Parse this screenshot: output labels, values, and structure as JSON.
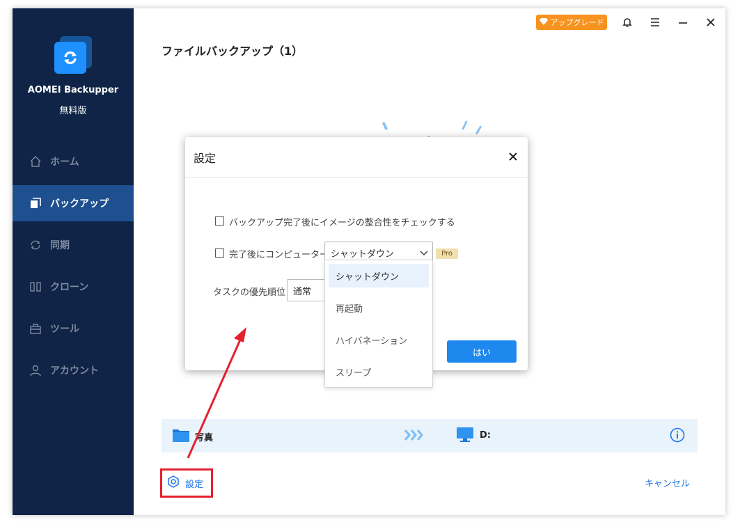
{
  "app": {
    "name": "AOMEI Backupper",
    "edition": "無料版"
  },
  "sidebar": {
    "items": [
      {
        "label": "ホーム",
        "icon": "home-icon"
      },
      {
        "label": "バックアップ",
        "icon": "backup-icon",
        "active": true
      },
      {
        "label": "同期",
        "icon": "sync-icon"
      },
      {
        "label": "クローン",
        "icon": "clone-icon"
      },
      {
        "label": "ツール",
        "icon": "tools-icon"
      },
      {
        "label": "アカウント",
        "icon": "account-icon"
      }
    ]
  },
  "topbar": {
    "upgrade_label": "アップグレード"
  },
  "page": {
    "title": "ファイルバックアップ（1）"
  },
  "dialog": {
    "title": "設定",
    "check_image_label": "バックアップ完了後にイメージの整合性をチェックする",
    "after_complete_label": "完了後にコンピューターを",
    "after_complete_value": "シャットダウン",
    "pro_badge": "Pro",
    "priority_label": "タスクの優先順位",
    "priority_value": "通常",
    "yes_label": "はい"
  },
  "dropdown": {
    "options": [
      "シャットダウン",
      "再起動",
      "ハイバネーション",
      "スリープ"
    ],
    "selected": "シャットダウン"
  },
  "task": {
    "source": "写真",
    "destination": "D:"
  },
  "footer": {
    "settings_label": "設定",
    "cancel_label": "キャンセル"
  },
  "colors": {
    "sidebar_bg": "#0f2446",
    "active_nav": "#1e4f8f",
    "accent": "#1e88ee",
    "upgrade": "#f7931e",
    "highlight": "#e5202e"
  }
}
